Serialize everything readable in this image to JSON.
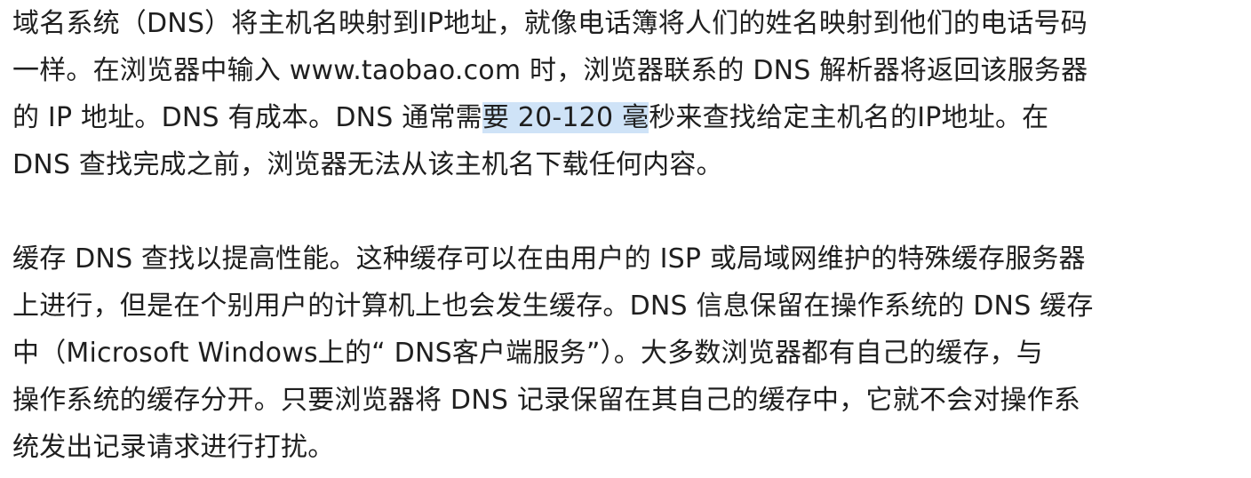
{
  "paragraphs": [
    {
      "lines": [
        {
          "text": "域名系统（DNS）将主机名映射到IP地址，就像电话簿将人们的姓名映射到他们的电话号码"
        },
        {
          "text": "一样。在浏览器中输入 www.taobao.com 时，浏览器联系的 DNS 解析器将返回该服务器"
        },
        {
          "before": "的 IP 地址。DNS 有成本。DNS 通常需",
          "highlight": "要 20-120 毫",
          "after": "秒来查找给定主机名的IP地址。在"
        },
        {
          "text": "DNS 查找完成之前，浏览器无法从该主机名下载任何内容。"
        }
      ]
    },
    {
      "lines": [
        {
          "text": "缓存 DNS 查找以提高性能。这种缓存可以在由用户的 ISP 或局域网维护的特殊缓存服务器"
        },
        {
          "text": "上进行，但是在个别用户的计算机上也会发生缓存。DNS 信息保留在操作系统的 DNS 缓存"
        },
        {
          "text": "中（Microsoft Windows上的“ DNS客户端服务”）。大多数浏览器都有自己的缓存，与"
        },
        {
          "text": "操作系统的缓存分开。只要浏览器将 DNS 记录保留在其自己的缓存中，它就不会对操作系"
        },
        {
          "text": "统发出记录请求进行打扰。"
        }
      ]
    }
  ],
  "colors": {
    "text": "#1f1f1f",
    "selection_highlight": "#cfe3f7",
    "background": "#ffffff"
  }
}
